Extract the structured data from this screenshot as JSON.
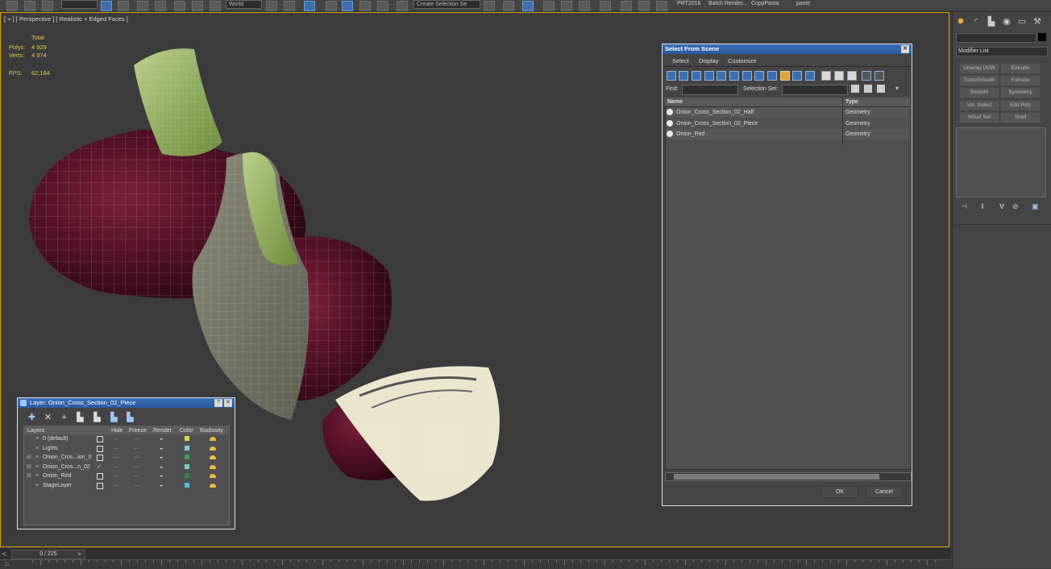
{
  "toolbar": {
    "ref_coord": "World",
    "named_sel": "Create Selection Se",
    "items": [
      "PRT2016",
      "Batch Render...",
      "CopyPasta",
      "paste"
    ]
  },
  "viewport": {
    "label": "[ + ] [ Perspective ] [ Realistic + Edged Faces ]",
    "stats": {
      "total_label": "Total",
      "polys_label": "Polys:",
      "polys_value": "4 929",
      "verts_label": "Verts:",
      "verts_value": "4 974",
      "fps_label": "FPS:",
      "fps_value": "62,184"
    }
  },
  "command_panel": {
    "modifier_list": "Modifier List",
    "buttons": [
      "Unwrap UVW",
      "Extrude",
      "TurboSmooth",
      "Extrude",
      "Smooth",
      "Symmetry",
      "Vol. Select",
      "Edit Poly",
      "NSurf Sel",
      "Shell"
    ]
  },
  "select_dialog": {
    "title": "Select From Scene",
    "menu": [
      "Select",
      "Display",
      "Customize"
    ],
    "find_label": "Find:",
    "selset_label": "Selection Set:",
    "columns": [
      "Name",
      "Type"
    ],
    "rows": [
      {
        "name": "Onion_Cross_Section_02_Half",
        "type": "Geometry"
      },
      {
        "name": "Onion_Cross_Section_02_Piece",
        "type": "Geometry"
      },
      {
        "name": "Onion_Red",
        "type": "Geometry"
      }
    ],
    "ok": "OK",
    "cancel": "Cancel"
  },
  "layer_dialog": {
    "title": "Layer: Onion_Cross_Section_02_Piece",
    "headers": [
      "Layers",
      "Hide",
      "Freeze",
      "Render",
      "Color",
      "Radiosity"
    ],
    "rows": [
      {
        "name": "0 (default)",
        "color": "#d9d64a"
      },
      {
        "name": "Lights",
        "color": "#6fd0e0"
      },
      {
        "name": "Onion_Cros...ion_0",
        "color": "#3aa050"
      },
      {
        "name": "Onion_Cros...n_02",
        "color": "#70d0c0"
      },
      {
        "name": "Onion_Red",
        "color": "#2e8a3c"
      },
      {
        "name": "StageLayer",
        "color": "#4cc0e0"
      }
    ]
  },
  "timeline": {
    "frame": "0 / 225"
  }
}
